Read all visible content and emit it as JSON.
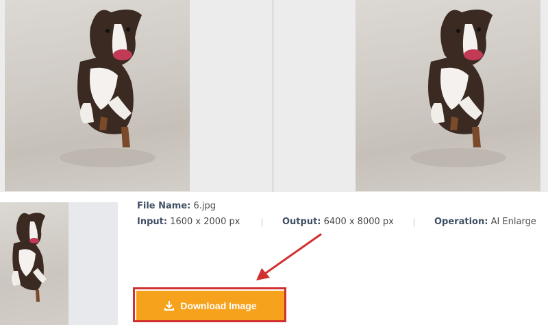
{
  "file": {
    "name_label": "File Name:",
    "name_value": "6.jpg"
  },
  "input": {
    "label": "Input:",
    "value": "1600 x 2000 px"
  },
  "output": {
    "label": "Output:",
    "value": "6400 x 8000 px"
  },
  "operation": {
    "label": "Operation:",
    "value": "AI Enlarge"
  },
  "download": {
    "label": "Download Image",
    "icon": "download-icon"
  },
  "colors": {
    "button": "#f7a21c",
    "highlight": "#d22f2f",
    "label_text": "#3f4f63"
  }
}
